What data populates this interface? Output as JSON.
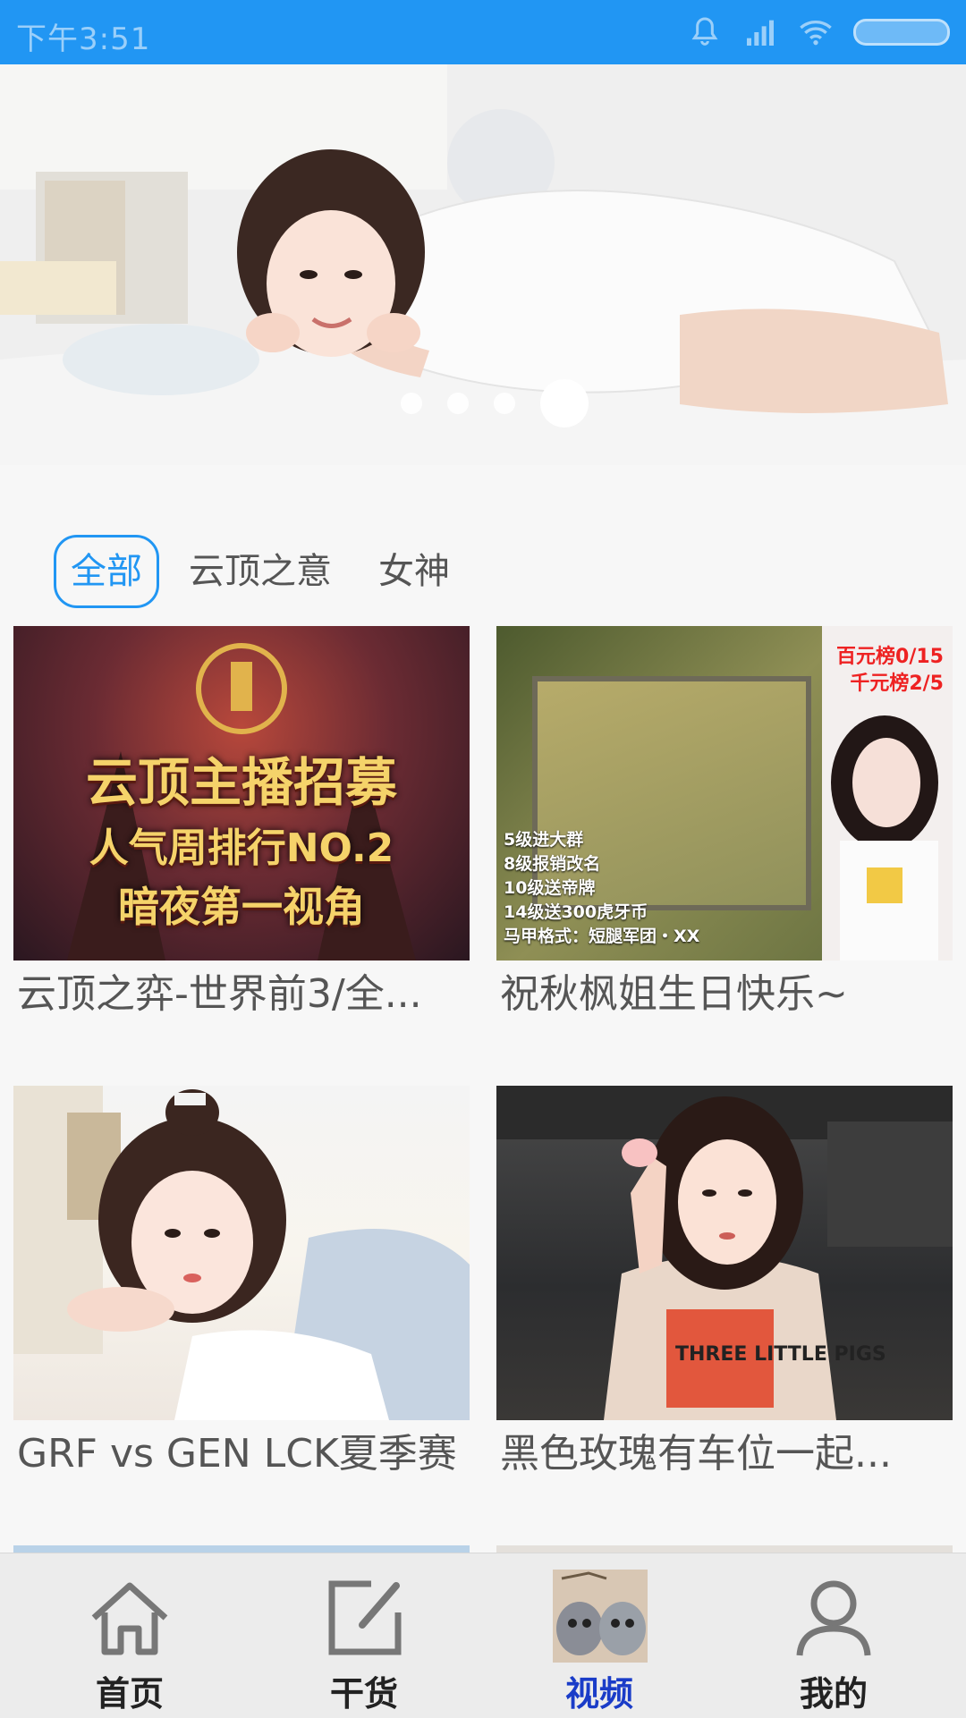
{
  "status_bar": {
    "time": "下午3:51",
    "icons": [
      "bell-icon",
      "signal-icon",
      "wifi-icon",
      "battery-icon"
    ]
  },
  "banner": {
    "image": "woman-on-bed-photo",
    "indicator_count": 4,
    "active_indicator": 4
  },
  "filters": {
    "items": [
      "全部",
      "云顶之意",
      "女神"
    ],
    "active": "全部"
  },
  "videos": [
    {
      "title": "云顶之弈-世界前3/全...",
      "thumb_text": [
        "云顶主播招募",
        "人气周排行NO.2",
        "暗夜第一视角"
      ]
    },
    {
      "title": "祝秋枫姐生日快乐~",
      "thumb_text": {
        "rank1": "百元榜0/15",
        "rank2": "千元榜2/5",
        "notes": [
          "5级进大群",
          "8级报销改名",
          "10级送帝牌",
          "14级送300虎牙币",
          "马甲格式：短腿军团・XX"
        ]
      }
    },
    {
      "title": "GRF vs GEN LCK夏季赛"
    },
    {
      "title": "黑色玫瑰有车位一起...",
      "thumb_text": [
        "THREE LITTLE PIGS"
      ]
    }
  ],
  "bottom_nav": {
    "items": [
      {
        "label": "首页",
        "icon": "home-icon"
      },
      {
        "label": "干货",
        "icon": "edit-icon"
      },
      {
        "label": "视频",
        "icon": "cats-image-icon"
      },
      {
        "label": "我的",
        "icon": "user-icon"
      }
    ],
    "active": "视频"
  },
  "colors": {
    "accent": "#2196f3",
    "nav_active": "#1a3cc8"
  }
}
